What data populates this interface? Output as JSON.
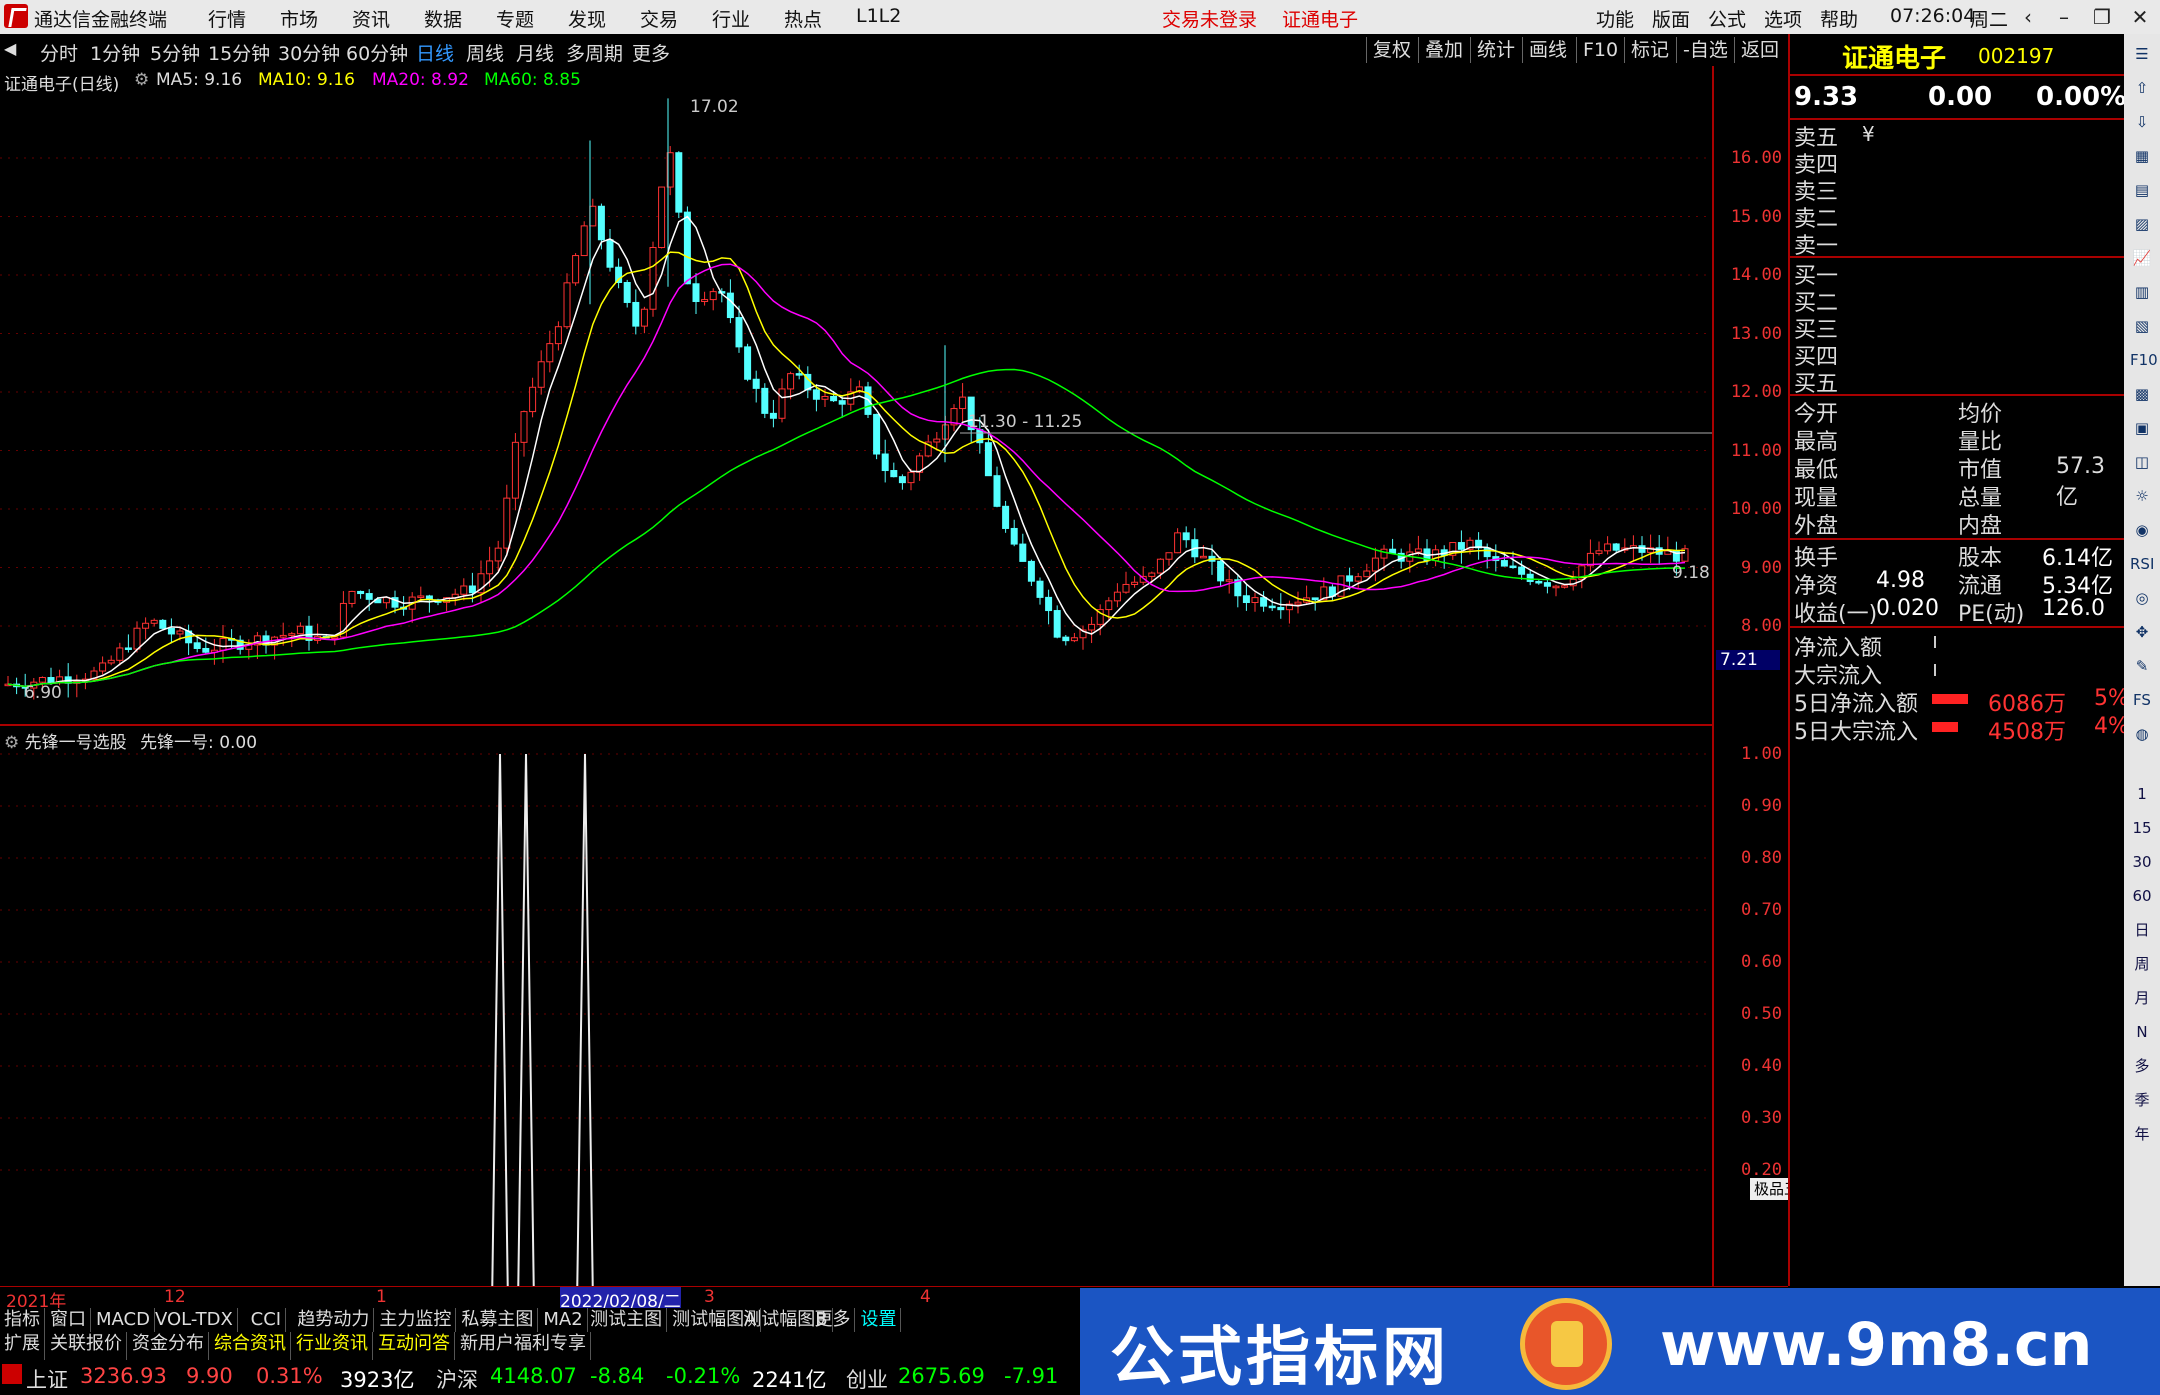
{
  "titlebar": {
    "app_title": "通达信金融终端",
    "menus": [
      "行情",
      "市场",
      "资讯",
      "数据",
      "专题",
      "发现",
      "交易",
      "行业",
      "热点",
      "L1L2"
    ],
    "login_status": "交易未登录",
    "stock_name": "证通电子",
    "right_menus": [
      "功能",
      "版面",
      "公式",
      "选项",
      "帮助"
    ],
    "clock": "07:26:04",
    "weekday": "周二"
  },
  "toolbar": {
    "periods": [
      "分时",
      "1分钟",
      "5分钟",
      "15分钟",
      "30分钟",
      "60分钟",
      "日线",
      "周线",
      "月线",
      "多周期",
      "更多"
    ],
    "active_period": "日线",
    "right_buttons": [
      "复权",
      "叠加",
      "统计",
      "画线",
      "F10",
      "标记",
      "-自选",
      "返回"
    ]
  },
  "chart": {
    "title": "证通电子(日线)",
    "ma": [
      {
        "label": "MA5: 9.16",
        "color": "#ffffff"
      },
      {
        "label": "MA10: 9.16",
        "color": "#ffff00"
      },
      {
        "label": "MA20: 8.92",
        "color": "#ff00ff"
      },
      {
        "label": "MA60: 8.85",
        "color": "#00ff00"
      }
    ],
    "annotations": {
      "high": "17.02",
      "low": "6.90",
      "line_label": "11.30 - 11.25",
      "last_value": "9.18",
      "cursor_value": "7.21"
    },
    "y_labels": [
      "16.00",
      "15.00",
      "14.00",
      "13.00",
      "12.00",
      "11.00",
      "10.00",
      "9.00",
      "8.00"
    ],
    "sub_title": "先锋一号选股",
    "sub_value": "先锋一号: 0.00",
    "sub_y_labels": [
      "1.00",
      "0.90",
      "0.80",
      "0.70",
      "0.60",
      "0.50",
      "0.40",
      "0.30",
      "0.20"
    ],
    "dates": [
      "2021年",
      "12",
      "1",
      "2022/02/08/二",
      "3",
      "4"
    ],
    "mini_label": "极品五笔"
  },
  "chart_data": {
    "type": "candlestick",
    "y_range": [
      6.9,
      17.02
    ],
    "moving_averages": [
      "MA5",
      "MA10",
      "MA20",
      "MA60"
    ],
    "ma_values": {
      "MA5": 9.16,
      "MA10": 9.16,
      "MA20": 8.92,
      "MA60": 8.85
    },
    "indicator": {
      "name": "先锋一号",
      "signal_days": 3,
      "signal_value": 1.0,
      "current": 0.0
    }
  },
  "panel": {
    "name": "证通电子",
    "code": "002197",
    "price": "9.33",
    "change": "0.00",
    "pct": "0.00%",
    "asks": [
      "卖五",
      "卖四",
      "卖三",
      "卖二",
      "卖一"
    ],
    "bids": [
      "买一",
      "买二",
      "买三",
      "买四",
      "买五"
    ],
    "yen": "¥",
    "info_left": [
      "今开",
      "最高",
      "最低",
      "现量",
      "外盘"
    ],
    "info_right": [
      "均价",
      "量比",
      "市值",
      "总量",
      "内盘"
    ],
    "market_value": "57.3亿",
    "stats": [
      {
        "l": "换手",
        "v": "",
        "r": "股本",
        "rv": "6.14亿"
      },
      {
        "l": "净资",
        "v": "4.98",
        "r": "流通",
        "rv": "5.34亿"
      },
      {
        "l": "收益(一)",
        "v": "0.020",
        "r": "PE(动)",
        "rv": "126.0"
      }
    ],
    "flows": [
      {
        "label": "净流入额",
        "amount": "",
        "pct": ""
      },
      {
        "label": "大宗流入",
        "amount": "",
        "pct": ""
      },
      {
        "label": "5日净流入额",
        "amount": "6086万",
        "pct": "5%"
      },
      {
        "label": "5日大宗流入",
        "amount": "4508万",
        "pct": "4%"
      }
    ]
  },
  "sidebar_icons": [
    "1",
    "15",
    "30",
    "60",
    "日",
    "周",
    "月",
    "N",
    "多",
    "季",
    "年"
  ],
  "bottom_tabs1": [
    "指标",
    "窗口",
    "MACD",
    "VOL-TDX",
    "CCI",
    "趋势动力",
    "主力监控",
    "私募主图",
    "MA2",
    "测试主图",
    "测试幅图A",
    "测试幅图B",
    "更多",
    "设置"
  ],
  "bottom_tabs2": [
    "扩展",
    "关联报价",
    "资金分布",
    "综合资讯",
    "行业资讯",
    "互动问答",
    "新用户福利专享"
  ],
  "status": {
    "sh_label": "上证",
    "sh_value": "3236.93",
    "sh_change": "9.90",
    "sh_pct": "0.31%",
    "sh_amount": "3923亿",
    "hs_label": "沪深",
    "hs_value": "4148.07",
    "hs_change": "-8.84",
    "hs_pct": "-0.21%",
    "hs_amount": "2241亿",
    "cy_label": "创业",
    "cy_value": "2675.69",
    "cy_change": "-7.91"
  },
  "banner": {
    "text": "公式指标网",
    "url": "www.9m8.cn"
  }
}
